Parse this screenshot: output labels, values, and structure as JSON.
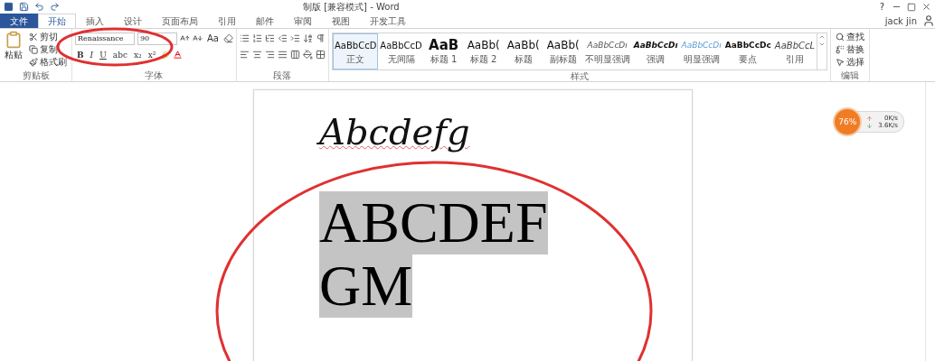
{
  "window": {
    "title": "制版 [兼容模式] - Word",
    "help": "?",
    "user": "jack jin"
  },
  "tabs": [
    {
      "label": "文件",
      "kind": "file",
      "selected": false
    },
    {
      "label": "开始",
      "kind": "tab",
      "selected": true
    },
    {
      "label": "插入",
      "kind": "tab",
      "selected": false
    },
    {
      "label": "设计",
      "kind": "tab",
      "selected": false
    },
    {
      "label": "页面布局",
      "kind": "tab",
      "selected": false
    },
    {
      "label": "引用",
      "kind": "tab",
      "selected": false
    },
    {
      "label": "邮件",
      "kind": "tab",
      "selected": false
    },
    {
      "label": "审阅",
      "kind": "tab",
      "selected": false
    },
    {
      "label": "视图",
      "kind": "tab",
      "selected": false
    },
    {
      "label": "开发工具",
      "kind": "tab",
      "selected": false
    }
  ],
  "clipboard": {
    "label": "剪贴板",
    "paste": "粘贴",
    "items": [
      {
        "label": "剪切",
        "kind": "cut"
      },
      {
        "label": "复制",
        "kind": "copy"
      },
      {
        "label": "格式刷",
        "kind": "brush"
      }
    ]
  },
  "font": {
    "label": "字体",
    "font_name": "Renaissance",
    "font_size": "90",
    "case_button": "Aa",
    "format_buttons": [
      "B",
      "I",
      "U",
      "abc",
      "x₂",
      "x²"
    ]
  },
  "paragraph": {
    "label": "段落"
  },
  "styles": {
    "label": "样式",
    "items": [
      {
        "preview": "AaBbCcD",
        "label": "正文",
        "kind": "normal",
        "selected": true
      },
      {
        "preview": "AaBbCcD",
        "label": "无间隔",
        "kind": "normal",
        "selected": false
      },
      {
        "preview": "AaB",
        "label": "标题 1",
        "kind": "heading1",
        "selected": false
      },
      {
        "preview": "AaBb(",
        "label": "标题 2",
        "kind": "heading",
        "selected": false
      },
      {
        "preview": "AaBb(",
        "label": "标题",
        "kind": "heading",
        "selected": false
      },
      {
        "preview": "AaBb(",
        "label": "副标题",
        "kind": "heading",
        "selected": false
      },
      {
        "preview": "AaBbCcDı",
        "label": "不明显强调",
        "kind": "subtle",
        "selected": false
      },
      {
        "preview": "AaBbCcDı",
        "label": "强调",
        "kind": "emphasis",
        "selected": false
      },
      {
        "preview": "AaBbCcDı",
        "label": "明显强调",
        "kind": "intense",
        "selected": false
      },
      {
        "preview": "AaBbCcDc",
        "label": "要点",
        "kind": "strong",
        "selected": false
      },
      {
        "preview": "AaBbCcL",
        "label": "引用",
        "kind": "quote",
        "selected": false
      }
    ]
  },
  "editing": {
    "label": "编辑",
    "items": [
      {
        "label": "查找",
        "kind": "find"
      },
      {
        "label": "替换",
        "kind": "replace"
      },
      {
        "label": "选择",
        "kind": "select"
      }
    ]
  },
  "document": {
    "script_line": "Abcdefg",
    "highlighted_lines": [
      "ABCDEF",
      "GM"
    ]
  },
  "speed_widget": {
    "percent": "76%",
    "upload": "0K/s",
    "download": "3.6K/s"
  }
}
